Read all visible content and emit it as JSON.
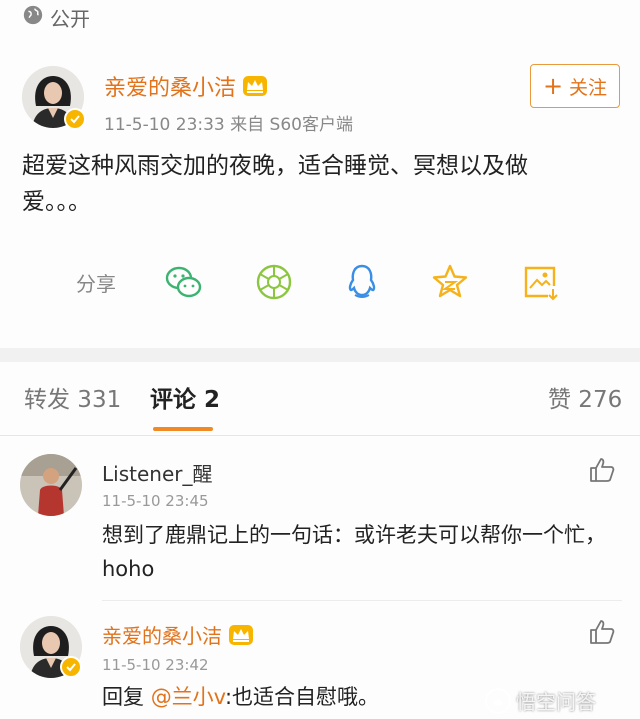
{
  "visibility": {
    "label": "公开",
    "icon": "globe-icon"
  },
  "post": {
    "author": "亲爱的桑小洁",
    "meta": "11-5-10 23:33  来自 S60客户端",
    "follow_label": "关注",
    "text": "超爱这种风雨交加的夜晚，适合睡觉、冥想以及做爱。。。"
  },
  "share": {
    "label": "分享",
    "icons": [
      "wechat-icon",
      "moments-icon",
      "qq-icon",
      "qzone-icon",
      "save-image-icon"
    ]
  },
  "tabs": {
    "repost": "转发 331",
    "comment": "评论 2",
    "like": "赞 276"
  },
  "comments": [
    {
      "name": "Listener_醒",
      "time": "11-5-10 23:45",
      "text": "想到了鹿鼎记上的一句话：或许老夫可以帮你一个忙，hoho"
    },
    {
      "name": "亲爱的桑小洁",
      "time": "11-5-10 23:42",
      "reply_prefix": "回复 ",
      "mention": "@兰小v",
      "reply_text": ":也适合自慰哦。"
    }
  ],
  "watermark": "悟空问答",
  "colors": {
    "accent": "#e2731a",
    "share_green": "#3cb371",
    "share_blue": "#3a8ee6",
    "share_yellow": "#f5b21b"
  }
}
